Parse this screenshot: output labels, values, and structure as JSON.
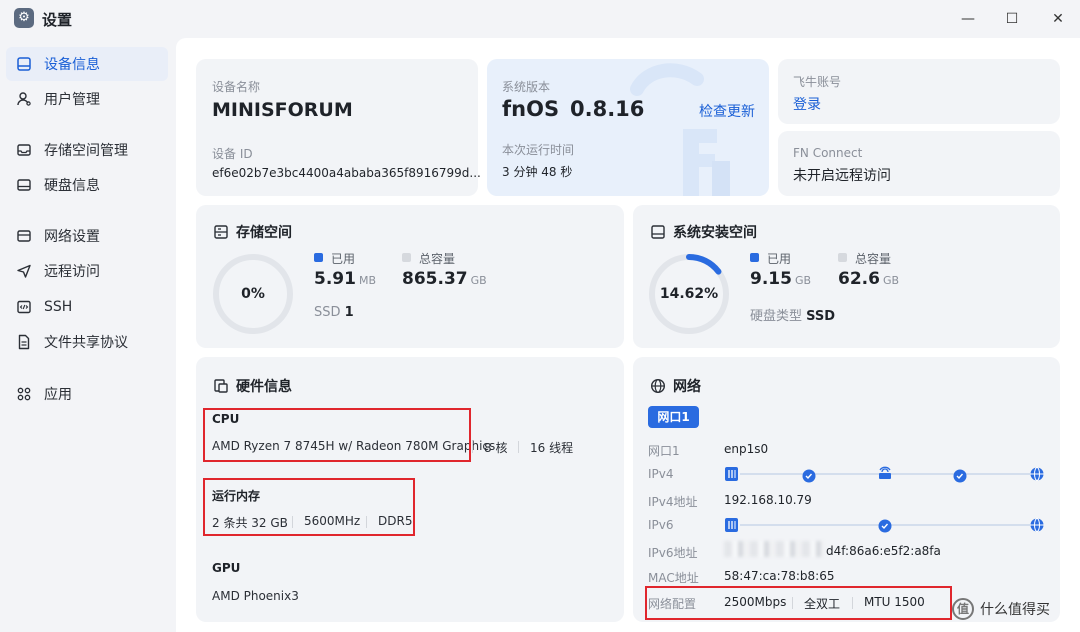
{
  "window": {
    "title": "设置",
    "minimize": "—",
    "maximize": "☐",
    "close": "✕"
  },
  "sidebar": {
    "items": [
      {
        "label": "设备信息",
        "active": true
      },
      {
        "label": "用户管理"
      },
      {
        "label": "存储空间管理"
      },
      {
        "label": "硬盘信息"
      },
      {
        "label": "网络设置"
      },
      {
        "label": "远程访问"
      },
      {
        "label": "SSH"
      },
      {
        "label": "文件共享协议"
      },
      {
        "label": "应用"
      }
    ]
  },
  "device": {
    "name_label": "设备名称",
    "name": "MINISFORUM",
    "id_label": "设备 ID",
    "id": "ef6e02b7e3bc4400a4ababa365f8916799d..."
  },
  "system": {
    "version_label": "系统版本",
    "os": "fnOS",
    "version": "0.8.16",
    "check_update": "检查更新",
    "uptime_label": "本次运行时间",
    "uptime": "3 分钟 48 秒"
  },
  "account": {
    "label": "飞牛账号",
    "login": "登录"
  },
  "fn_connect": {
    "label": "FN Connect",
    "status": "未开启远程访问"
  },
  "storage": {
    "title": "存储空间",
    "percent_text": "0%",
    "percent": 0,
    "used_label": "已用",
    "used_value": "5.91",
    "used_unit": "MB",
    "total_label": "总容量",
    "total_value": "865.37",
    "total_unit": "GB",
    "ssd_label": "SSD",
    "ssd_count": "1"
  },
  "system_space": {
    "title": "系统安装空间",
    "percent_text": "14.62%",
    "percent": 14.62,
    "used_label": "已用",
    "used_value": "9.15",
    "used_unit": "GB",
    "total_label": "总容量",
    "total_value": "62.6",
    "total_unit": "GB",
    "disk_type_label": "硬盘类型",
    "disk_type": "SSD"
  },
  "hardware": {
    "title": "硬件信息",
    "cpu_label": "CPU",
    "cpu_model": "AMD Ryzen 7 8745H w/ Radeon 780M Graphics",
    "cpu_cores": "8 核",
    "cpu_threads": "16 线程",
    "mem_label": "运行内存",
    "mem_size": "2 条共 32 GB",
    "mem_speed": "5600MHz",
    "mem_type": "DDR5",
    "gpu_label": "GPU",
    "gpu_model": "AMD Phoenix3"
  },
  "network": {
    "title": "网络",
    "tab": "网口1",
    "port_label": "网口1",
    "port_value": "enp1s0",
    "ipv4_label": "IPv4",
    "ipv4_addr_label": "IPv4地址",
    "ipv4_addr": "192.168.10.79",
    "ipv6_label": "IPv6",
    "ipv6_addr_label": "IPv6地址",
    "ipv6_addr_visible": "d4f:86a6:e5f2:a8fa",
    "mac_label": "MAC地址",
    "mac": "58:47:ca:78:b8:65",
    "config_label": "网络配置",
    "speed": "2500Mbps",
    "duplex": "全双工",
    "mtu": "MTU 1500"
  },
  "watermark": {
    "logo": "值",
    "text": "什么值得买"
  },
  "colors": {
    "accent": "#1a5fd6",
    "used": "#2a6be0",
    "total": "#d6d9de",
    "highlight": "#e0262d"
  }
}
